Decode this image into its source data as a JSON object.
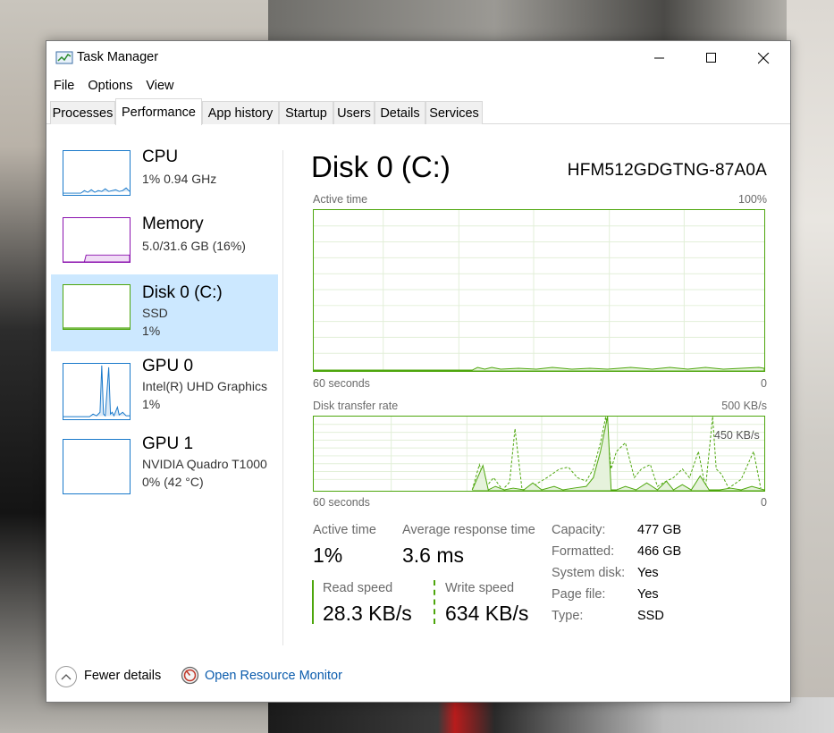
{
  "window": {
    "title": "Task Manager",
    "controls": {
      "minimize_icon": "minimize-icon",
      "maximize_icon": "maximize-icon",
      "close_icon": "close-icon"
    }
  },
  "menu": [
    "File",
    "Options",
    "View"
  ],
  "tabs": [
    "Processes",
    "Performance",
    "App history",
    "Startup",
    "Users",
    "Details",
    "Services"
  ],
  "active_tab": "Performance",
  "sidebar": {
    "items": [
      {
        "title": "CPU",
        "line1": "1% 0.94 GHz",
        "line2": "",
        "color": "#1979ca"
      },
      {
        "title": "Memory",
        "line1": "5.0/31.6 GB (16%)",
        "line2": "",
        "color": "#8b12ae"
      },
      {
        "title": "Disk 0 (C:)",
        "line1": "SSD",
        "line2": "1%",
        "color": "#4da60c"
      },
      {
        "title": "GPU 0",
        "line1": "Intel(R) UHD Graphics",
        "line2": "1%",
        "color": "#1979ca"
      },
      {
        "title": "GPU 1",
        "line1": "NVIDIA Quadro T1000",
        "line2": "0% (42 °C)",
        "color": "#1979ca"
      }
    ],
    "selected_index": 2
  },
  "main": {
    "title": "Disk 0 (C:)",
    "model": "HFM512GDGTNG-87A0A",
    "active_time_graph": {
      "label": "Active time",
      "max_label": "100%",
      "x_left": "60 seconds",
      "x_right": "0"
    },
    "transfer_graph": {
      "label": "Disk transfer rate",
      "max_label": "500 KB/s",
      "inner_label": "450 KB/s",
      "x_left": "60 seconds",
      "x_right": "0"
    },
    "stats": {
      "active_time_label": "Active time",
      "active_time_value": "1%",
      "avg_response_label": "Average response time",
      "avg_response_value": "3.6 ms",
      "read_label": "Read speed",
      "read_value": "28.3 KB/s",
      "write_label": "Write speed",
      "write_value": "634 KB/s"
    },
    "properties": [
      {
        "label": "Capacity:",
        "value": "477 GB"
      },
      {
        "label": "Formatted:",
        "value": "466 GB"
      },
      {
        "label": "System disk:",
        "value": "Yes"
      },
      {
        "label": "Page file:",
        "value": "Yes"
      },
      {
        "label": "Type:",
        "value": "SSD"
      }
    ]
  },
  "footer": {
    "fewer_details": "Fewer details",
    "open_resource_monitor": "Open Resource Monitor"
  },
  "colors": {
    "disk_green": "#4da60c",
    "selection": "#cce8ff",
    "link": "#0b5cad"
  }
}
